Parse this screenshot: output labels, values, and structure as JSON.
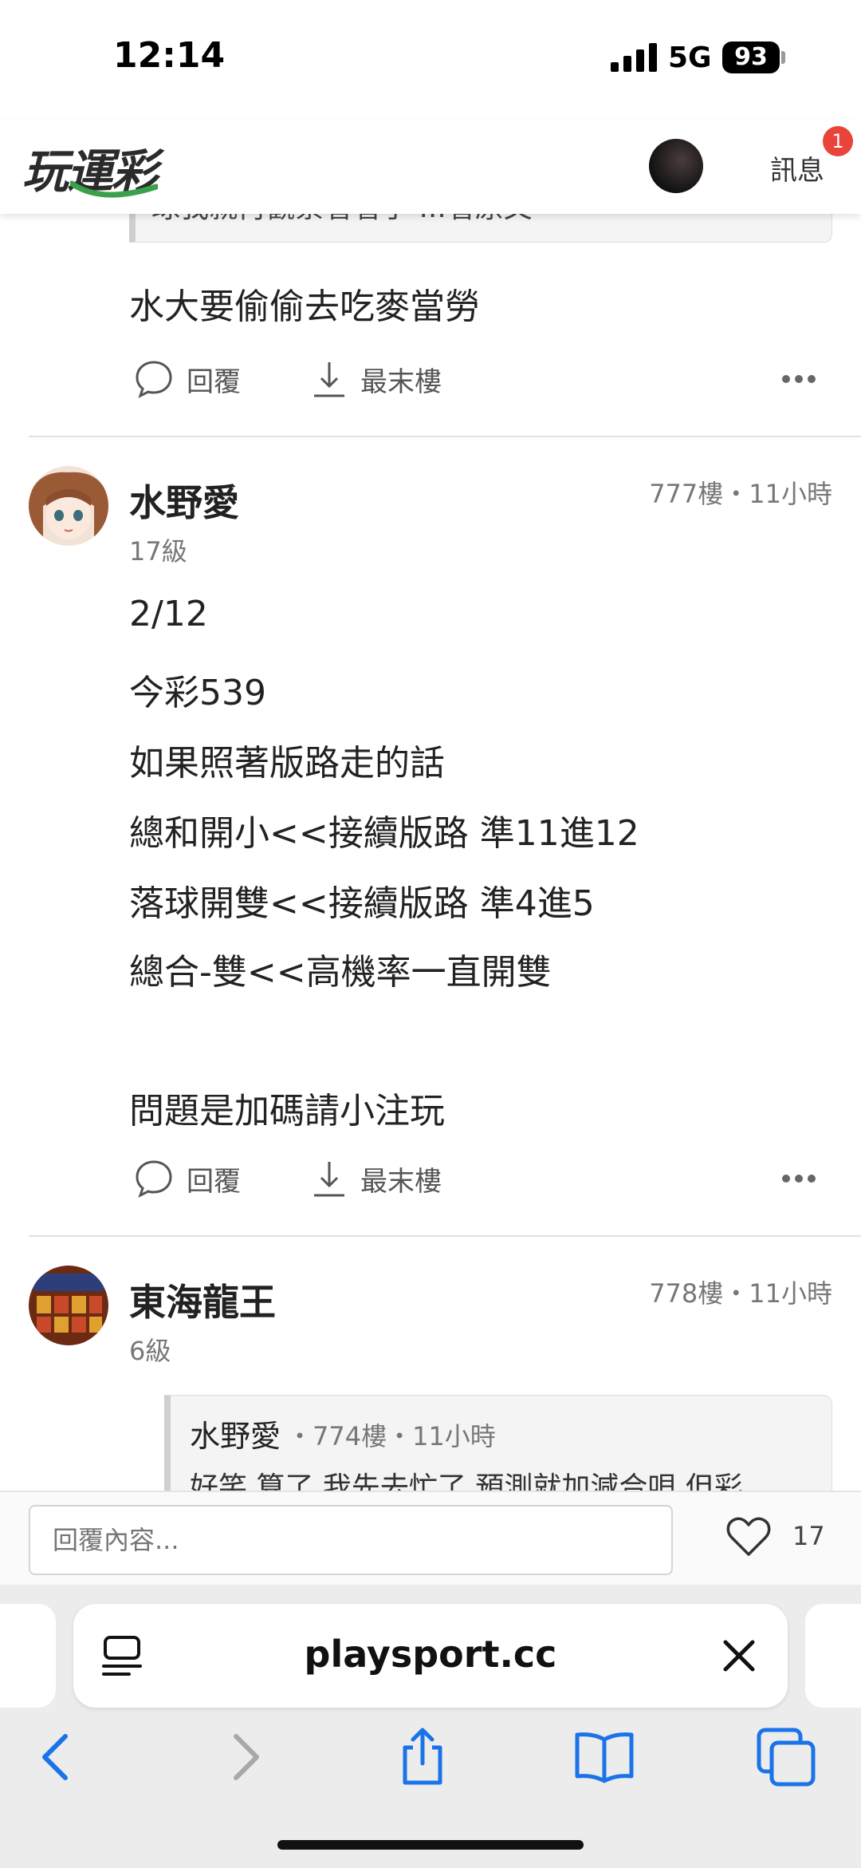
{
  "status_bar": {
    "time": "12:14",
    "network": "5G",
    "battery": "93"
  },
  "header": {
    "logo": "玩運彩",
    "messages_label": "訊息",
    "messages_badge": "1"
  },
  "prev_post": {
    "quote_text": "球我就再觀察看看了 ...看原文",
    "body": "水大要偷偷去吃麥當勞",
    "reply_label": "回覆",
    "last_floor_label": "最末樓"
  },
  "post_777": {
    "author": "水野愛",
    "level": "17級",
    "meta": "777樓・11小時",
    "lines": [
      "2/12",
      "今彩539",
      "如果照著版路走的話",
      "總和開小<<接續版路 準11進12",
      "落球開雙<<接續版路 準4進5",
      "總合-雙<<高機率一直開雙",
      "問題是加碼請小注玩"
    ],
    "reply_label": "回覆",
    "last_floor_label": "最末樓"
  },
  "post_778": {
    "author": "東海龍王",
    "level": "6級",
    "meta": "778樓・11小時",
    "quote_author": "水野愛",
    "quote_meta": "・774樓・11小時",
    "quote_text": "好笑 算了 我先去忙了 預測就加減合唄 但彩"
  },
  "reply_bar": {
    "placeholder": "回覆內容...",
    "like_count": "17"
  },
  "browser": {
    "url": "playsport.cc"
  },
  "colors": {
    "badge": "#e8443a",
    "ios_blue": "#1a73e8",
    "logo_green": "#3aa04a"
  }
}
